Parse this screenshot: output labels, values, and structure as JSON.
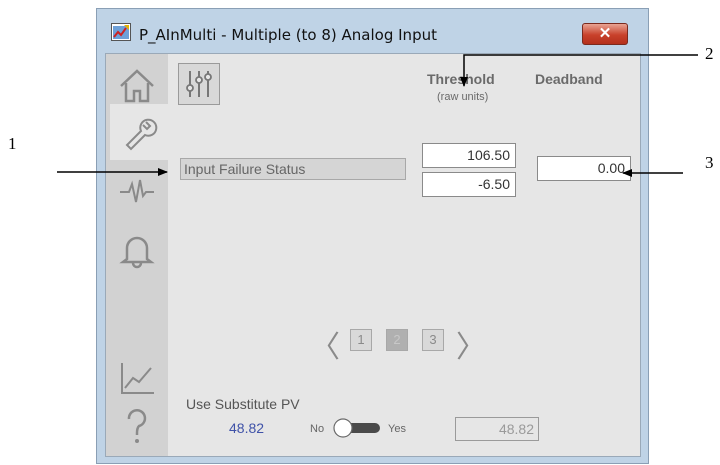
{
  "callouts": [
    "1",
    "2",
    "3"
  ],
  "window": {
    "title": "P_AInMulti - Multiple (to 8) Analog Input",
    "close_label": "✕"
  },
  "nav": {
    "items": [
      {
        "name": "home",
        "icon": "home-icon"
      },
      {
        "name": "maintenance",
        "icon": "wrench-icon",
        "active": true
      },
      {
        "name": "fault",
        "icon": "waveform-icon"
      },
      {
        "name": "alarms",
        "icon": "bell-icon"
      },
      {
        "name": "trends",
        "icon": "trend-icon"
      },
      {
        "name": "help",
        "icon": "help-icon"
      }
    ]
  },
  "settings_icon": "sliders-icon",
  "columns": {
    "threshold": "Threshold",
    "threshold_units": "(raw units)",
    "deadband": "Deadband"
  },
  "input_failure": {
    "label": "Input Failure Status",
    "threshold_high": "106.50",
    "threshold_low": "-6.50",
    "deadband": "0.00"
  },
  "pager": {
    "prev": "〈",
    "next": "〉",
    "pages": [
      "1",
      "2",
      "3"
    ],
    "current": "2"
  },
  "substitute_pv": {
    "label": "Use Substitute PV",
    "pv_value": "48.82",
    "toggle_off": "No",
    "toggle_on": "Yes",
    "toggle_state": "No",
    "substitute_value": "48.82"
  }
}
